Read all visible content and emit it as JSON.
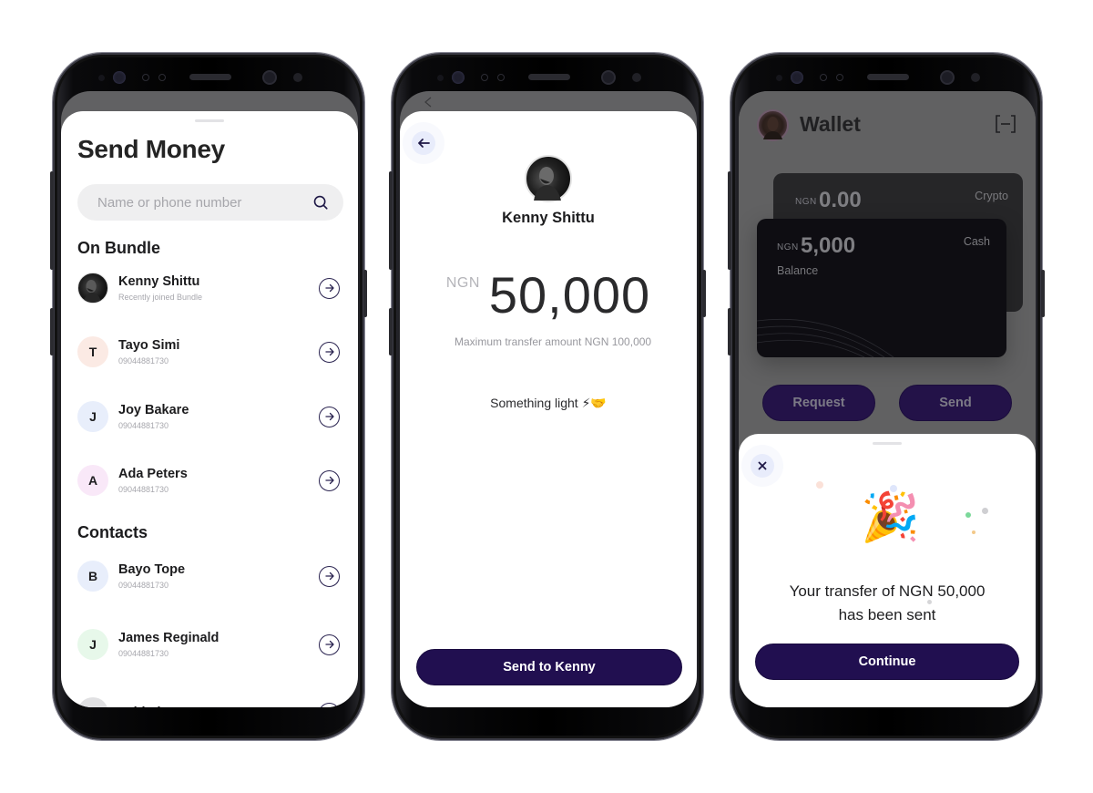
{
  "screens": {
    "send_money": {
      "title": "Send Money",
      "search": {
        "placeholder": "Name or phone number",
        "value": "",
        "icon": "search-icon"
      },
      "sections": {
        "on_bundle": {
          "heading": "On Bundle",
          "contacts": [
            {
              "name": "Kenny Shittu",
              "subtitle": "Recently joined Bundle",
              "avatar": "photo",
              "initial": ""
            },
            {
              "name": "Tayo Simi",
              "subtitle": "09044881730",
              "avatar": "initial",
              "initial": "T",
              "avatar_color": "#fbeae4"
            },
            {
              "name": "Joy Bakare",
              "subtitle": "09044881730",
              "avatar": "initial",
              "initial": "J",
              "avatar_color": "#e8eefb"
            },
            {
              "name": "Ada Peters",
              "subtitle": "09044881730",
              "avatar": "initial",
              "initial": "A",
              "avatar_color": "#f9e8f8"
            }
          ]
        },
        "contacts": {
          "heading": "Contacts",
          "contacts": [
            {
              "name": "Bayo Tope",
              "subtitle": "09044881730",
              "avatar": "initial",
              "initial": "B",
              "avatar_color": "#e8eefb"
            },
            {
              "name": "James Reginald",
              "subtitle": "09044881730",
              "avatar": "initial",
              "initial": "J",
              "avatar_color": "#e7f8ea"
            },
            {
              "name": "Tobi Idowu",
              "subtitle": "",
              "avatar": "initial",
              "initial": "",
              "avatar_color": "#e0e0e2",
              "partially_hidden": true
            }
          ]
        }
      },
      "row_action_icon": "arrow-right-circle-icon"
    },
    "amount": {
      "back_icon": "arrow-left-icon",
      "recipient_name": "Kenny Shittu",
      "currency": "NGN",
      "amount": "50,000",
      "max_note": "Maximum transfer amount NGN 100,000",
      "note": "Something light ⚡🤝",
      "primary_button": "Send to Kenny"
    },
    "wallet": {
      "title": "Wallet",
      "scan_icon": "scan-icon",
      "cards": {
        "crypto": {
          "currency": "NGN",
          "amount": "0.00",
          "type": "Crypto"
        },
        "cash": {
          "currency": "NGN",
          "amount": "5,000",
          "type": "Cash",
          "label": "Balance"
        }
      },
      "buttons": {
        "request": "Request",
        "send": "Send"
      },
      "success_sheet": {
        "close_icon": "close-icon",
        "celebration_emoji": "🎉",
        "message_line1": "Your transfer of NGN 50,000",
        "message_line2": "has been sent",
        "primary_button": "Continue"
      }
    }
  },
  "colors": {
    "primary": "#210f50",
    "icon_bg": "#e8ecfb",
    "overlay": "#616162"
  }
}
